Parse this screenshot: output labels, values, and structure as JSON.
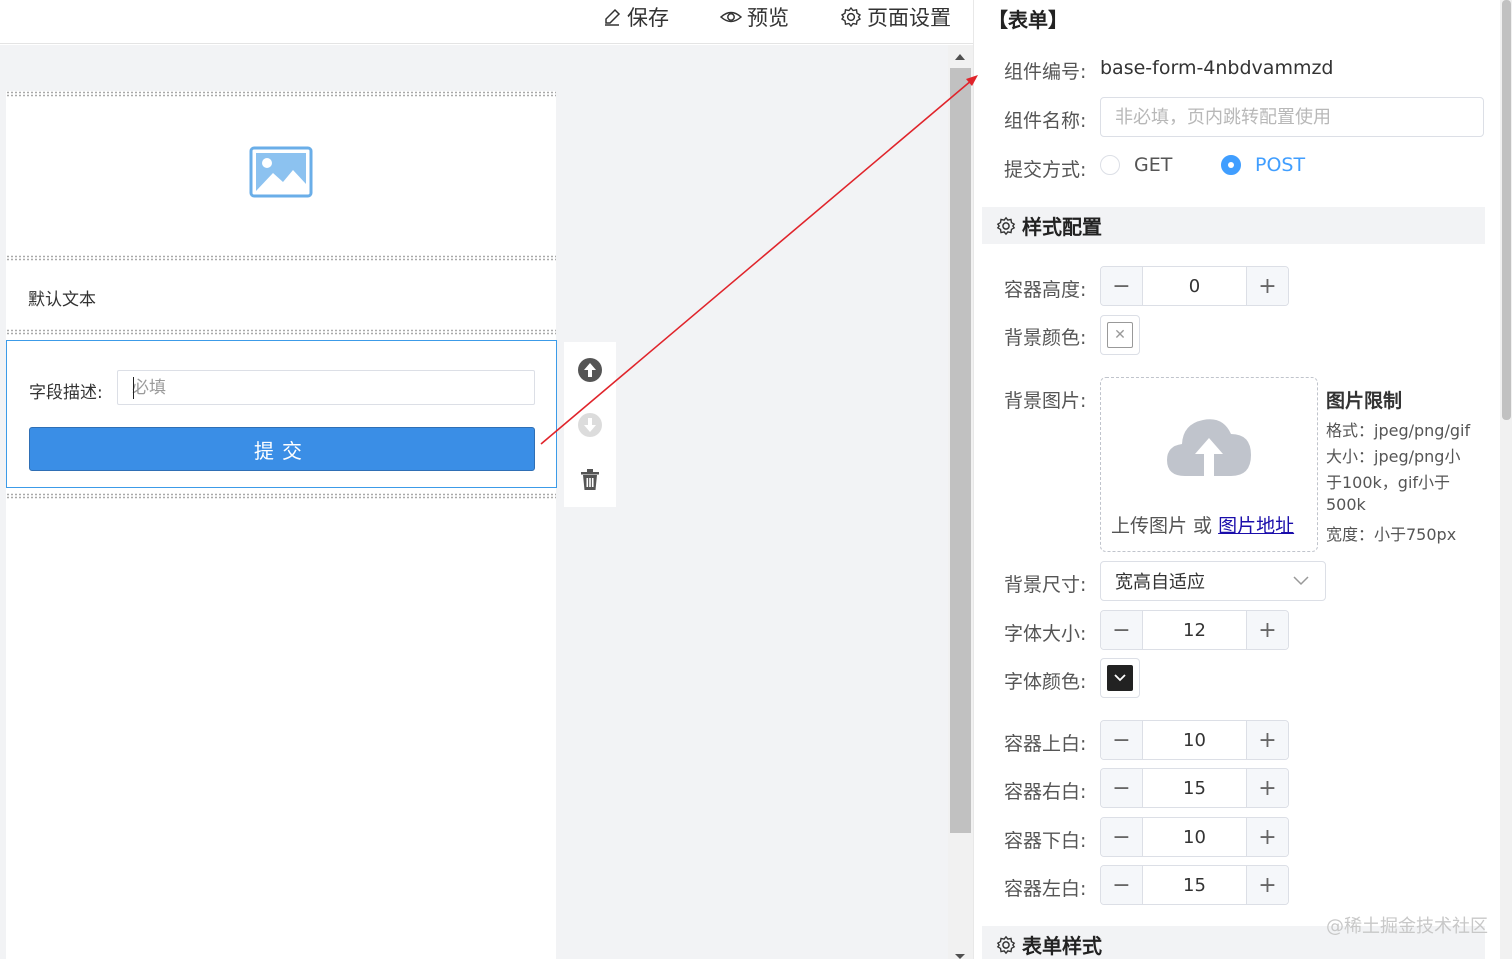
{
  "toolbar": {
    "save": "保存",
    "preview": "预览",
    "page_settings": "页面设置"
  },
  "canvas": {
    "text_block": "默认文本",
    "form": {
      "field_label": "字段描述:",
      "field_placeholder": "必填",
      "submit_label": "提交"
    },
    "ops": {
      "move_up": "arrow-up-circle-icon",
      "move_down": "arrow-down-circle-icon",
      "delete": "trash-icon"
    }
  },
  "panel": {
    "title": "【表单】",
    "component_id_label": "组件编号:",
    "component_id": "base-form-4nbdvammzd",
    "component_name_label": "组件名称:",
    "component_name_placeholder": "非必填，页内跳转配置使用",
    "submit_method_label": "提交方式:",
    "submit_methods": [
      {
        "label": "GET",
        "checked": false
      },
      {
        "label": "POST",
        "checked": true
      }
    ],
    "style_section": "样式配置",
    "container_height_label": "容器高度:",
    "container_height": "0",
    "bg_color_label": "背景颜色:",
    "bg_image_label": "背景图片:",
    "upload_text": "上传图片 或",
    "upload_link": "图片地址",
    "limit_title": "图片限制",
    "limit_lines": [
      "格式：jpeg/png/gif",
      "大小：jpeg/png小",
      "于100k，gif小于",
      "500k",
      "宽度：小于750px"
    ],
    "bg_size_label": "背景尺寸:",
    "bg_size_value": "宽高自适应",
    "font_size_label": "字体大小:",
    "font_size": "12",
    "font_color_label": "字体颜色:",
    "font_color": "#222222",
    "padding_top_label": "容器上白:",
    "padding_top": "10",
    "padding_right_label": "容器右白:",
    "padding_right": "15",
    "padding_bottom_label": "容器下白:",
    "padding_bottom": "10",
    "padding_left_label": "容器左白:",
    "padding_left": "15",
    "form_style_section": "表单样式",
    "stepper_minus": "−",
    "stepper_plus": "+"
  },
  "watermark": "@稀土掘金技术社区",
  "colors": {
    "accent": "#409eff",
    "submit_button": "#3a8ee6",
    "selection_border": "#3c9be8",
    "arrow": "#e0242b"
  }
}
